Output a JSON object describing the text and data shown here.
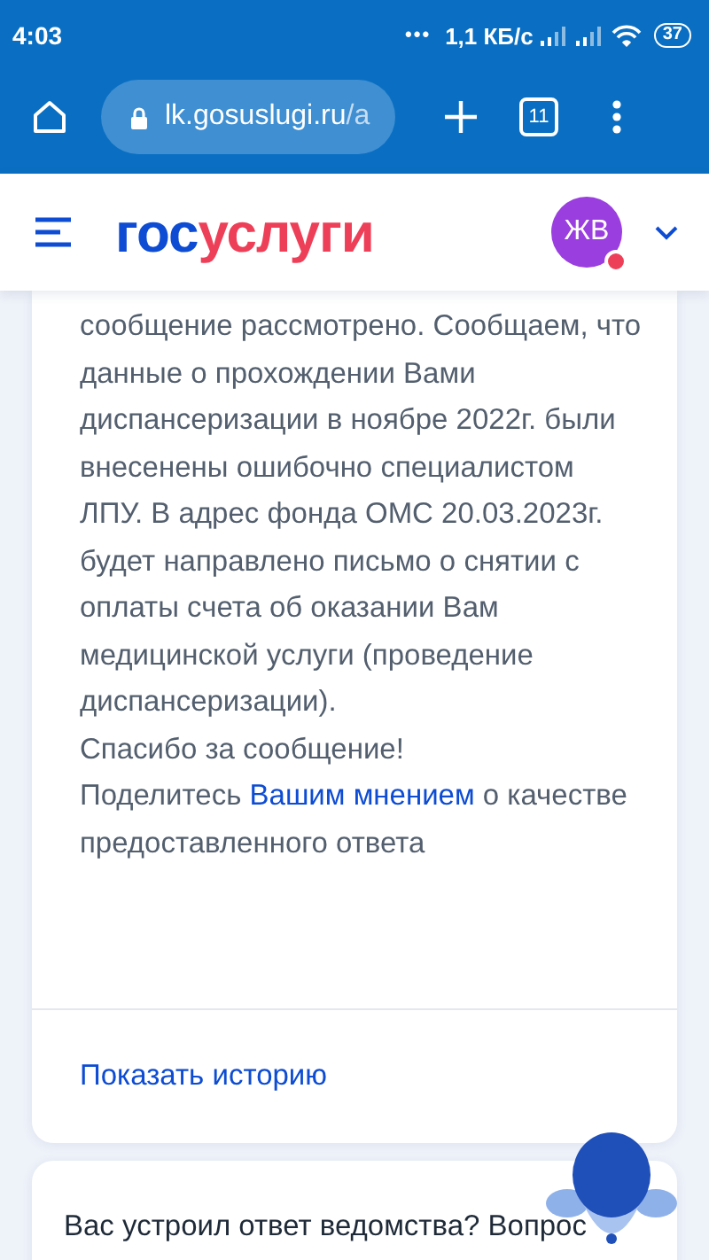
{
  "status_bar": {
    "time": "4:03",
    "dots": "•••",
    "speed": "1,1 КБ/с",
    "battery": "37"
  },
  "browser": {
    "url_host": "lk.gosuslugi.ru",
    "url_rest": "/a",
    "tab_count": "11"
  },
  "header": {
    "logo_first": "гос",
    "logo_second": "услуги",
    "avatar": "ЖВ",
    "has_notification": true
  },
  "message": {
    "body": "сообщение рассмотрено. Сообщаем, что данные о прохождении Вами диспансеризации в ноябре 2022г. были внесенены ошибочно специалистом ЛПУ. В адрес фонда ОМС 20.03.2023г. будет направлено письмо о снятии с оплаты счета об оказании Вам медицинской услуги (проведение диспансеризации).",
    "thanks": "Спасибо за сообщение!",
    "feedback_before": "Поделитесь",
    "feedback_link": "Вашим мнением",
    "feedback_after": "о качестве предоставленного ответа",
    "history_link": "Показать историю"
  },
  "survey": {
    "question": "Вас устроил ответ ведомства? Вопрос"
  }
}
